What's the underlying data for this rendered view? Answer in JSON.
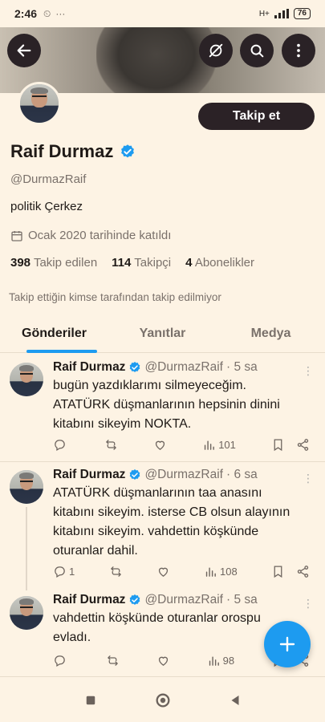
{
  "status_bar": {
    "time": "2:46",
    "battery": "76",
    "network": "H+"
  },
  "profile": {
    "name": "Raif Durmaz",
    "handle": "@DurmazRaif",
    "bio": "politik Çerkez",
    "joined": "Ocak 2020 tarihinde katıldı",
    "follow_button": "Takip et",
    "stats": [
      {
        "count": "398",
        "label": "Takip edilen"
      },
      {
        "count": "114",
        "label": "Takipçi"
      },
      {
        "count": "4",
        "label": "Abonelikler"
      }
    ],
    "not_followed_note": "Takip ettiğin kimse tarafından takip edilmiyor"
  },
  "tabs": [
    "Gönderiler",
    "Yanıtlar",
    "Medya"
  ],
  "tweets": [
    {
      "name": "Raif Durmaz",
      "handle": "@DurmazRaif",
      "time": "· 5 sa",
      "lines": [
        "bugün yazdıklarımı silmeyeceğim.",
        "ATATÜRK düşmanlarının hepsinin dinini",
        "kitabını sikeyim NOKTA."
      ],
      "replies": "",
      "views": "101"
    },
    {
      "name": "Raif Durmaz",
      "handle": "@DurmazRaif",
      "time": "· 6 sa",
      "lines": [
        "ATATÜRK düşmanlarının taa anasını",
        "kitabını sikeyim. isterse CB olsun alayının",
        "kitabını sikeyim. vahdettin köşkünde",
        "oturanlar dahil."
      ],
      "replies": "1",
      "views": "108"
    },
    {
      "name": "Raif Durmaz",
      "handle": "@DurmazRaif",
      "time": "· 5 sa",
      "lines": [
        "vahdettin köşkünde oturanlar orospu",
        "evladı."
      ],
      "replies": "",
      "views": "98"
    }
  ],
  "colors": {
    "accent": "#1d9bf0",
    "dark_button": "#2b2226",
    "background": "#fdf3e4"
  }
}
